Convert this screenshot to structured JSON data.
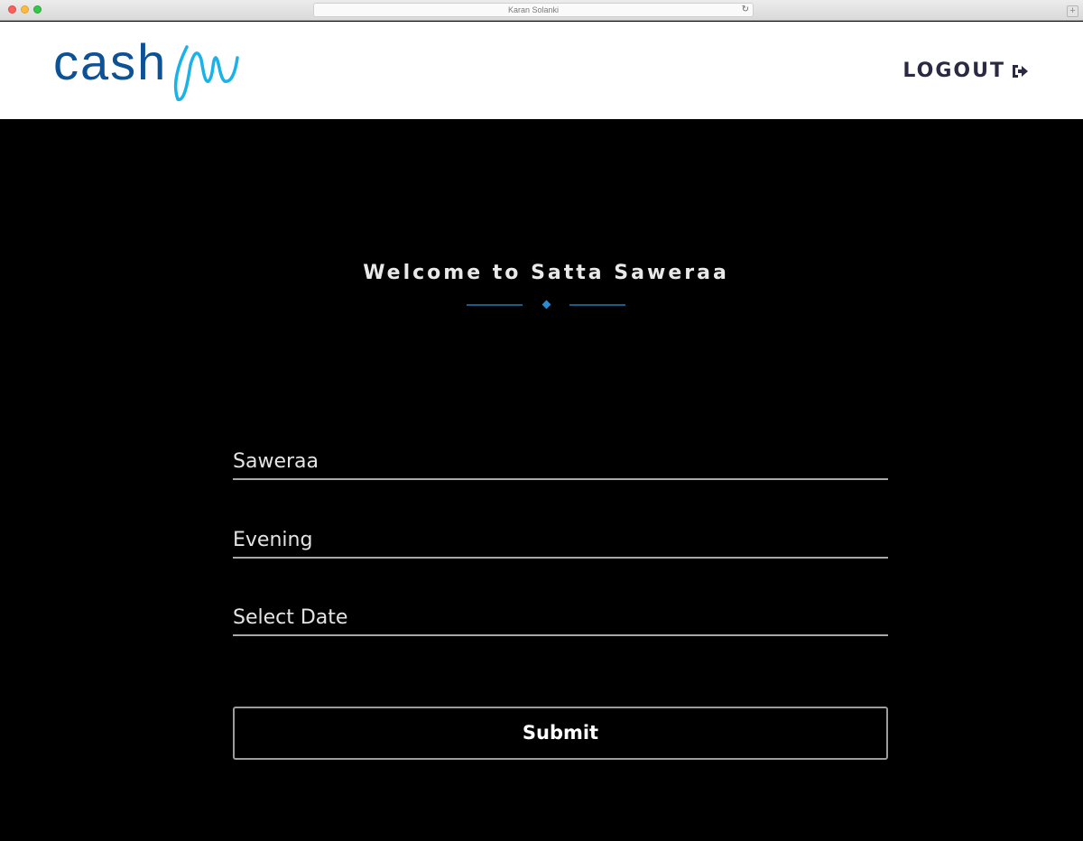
{
  "browser": {
    "address": "Karan Solanki",
    "new_tab": "+"
  },
  "header": {
    "logo_text": "cash",
    "logout_label": "LOGOUT",
    "brand_color": "#0d5196",
    "swirl_color": "#1ab2e8"
  },
  "main": {
    "title": "Welcome to Satta Saweraa",
    "fields": [
      {
        "value": "Saweraa"
      },
      {
        "value": "Evening"
      },
      {
        "value": "Select Date"
      }
    ],
    "submit_label": "Submit"
  }
}
